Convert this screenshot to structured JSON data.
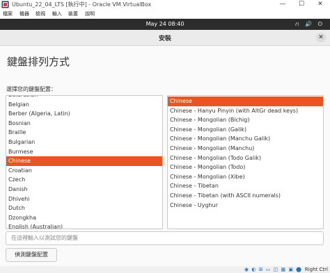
{
  "window": {
    "title": "Ubuntu_22_04_LTS [執行中] - Oracle VM VirtualBox",
    "minimize": "—",
    "maximize": "☐",
    "close": "✕"
  },
  "vbox_menu": [
    "檔案",
    "機器",
    "檢視",
    "輸入",
    "裝置",
    "說明"
  ],
  "topbar": {
    "clock": "May 24  08:40",
    "tray": "⛙ 🔊 ⏻"
  },
  "dialog": {
    "title": "安裝",
    "close": "✕"
  },
  "page": {
    "heading": "鍵盤排列方式",
    "list_label": "選擇您的鍵盤配置："
  },
  "layouts": [
    "Belarusian",
    "Belgian",
    "Berber (Algeria, Latin)",
    "Bosnian",
    "Braille",
    "Bulgarian",
    "Burmese",
    "Chinese",
    "Croatian",
    "Czech",
    "Danish",
    "Dhivehi",
    "Dutch",
    "Dzongkha",
    "English (Australian)"
  ],
  "layouts_selected_index": 7,
  "variants": [
    "Chinese",
    "Chinese - Hanyu Pinyin (with AltGr dead keys)",
    "Chinese - Mongolian (Bichig)",
    "Chinese - Mongolian (Galik)",
    "Chinese - Mongolian (Manchu Galik)",
    "Chinese - Mongolian (Manchu)",
    "Chinese - Mongolian (Todo Galik)",
    "Chinese - Mongolian (Todo)",
    "Chinese - Mongolian (Xibe)",
    "Chinese - Tibetan",
    "Chinese - Tibetan (with ASCII numerals)",
    "Chinese - Uyghur"
  ],
  "variants_selected_index": 0,
  "test_input": {
    "placeholder": "在這裡輸入以測試您的鍵盤"
  },
  "detect_button": "偵測鍵盤配置",
  "statusbar": {
    "icons": "◉ ◐ ⊞ ▭ ◫ ▦ ▣ ⬤",
    "hostkey": "Right Ctrl"
  },
  "colors": {
    "accent": "#e95420",
    "topbar": "#2c2c2c"
  }
}
